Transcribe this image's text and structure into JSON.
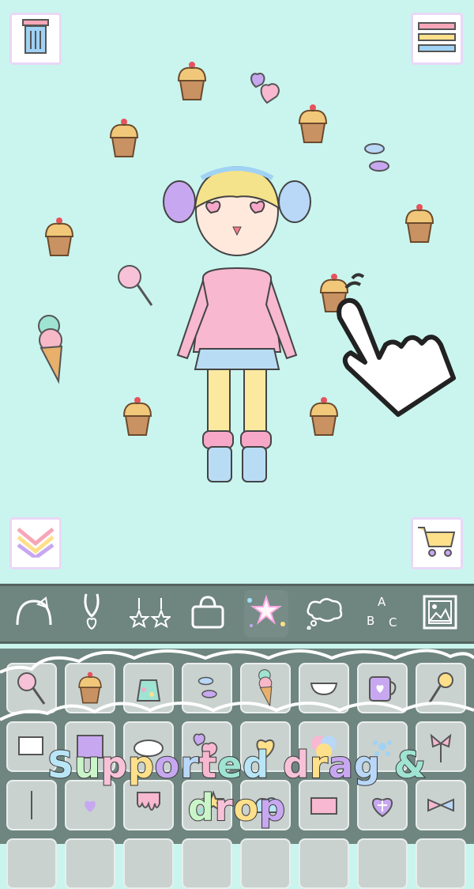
{
  "canvas": {
    "background": "#c9f5ee",
    "top_left_button": {
      "icon": "trash-icon"
    },
    "top_right_button": {
      "icon": "menu-icon"
    },
    "bottom_left_button": {
      "icon": "collapse-chevron-icon"
    },
    "bottom_right_button": {
      "icon": "shopping-cart-icon"
    }
  },
  "toolbar": {
    "tabs": [
      {
        "icon": "headband-icon"
      },
      {
        "icon": "necklace-icon"
      },
      {
        "icon": "star-earrings-icon"
      },
      {
        "icon": "handbag-icon"
      },
      {
        "icon": "sparkle-stars-icon",
        "selected": true
      },
      {
        "icon": "thought-cloud-icon"
      },
      {
        "icon": "abc-letters-icon",
        "text": "A B C"
      },
      {
        "icon": "picture-frame-icon"
      }
    ]
  },
  "banner": {
    "text": "Supported drag & drop"
  },
  "colors": {
    "mint": "#c9f5ee",
    "toolbar": "#6f8580",
    "cell": "#c9d2cf"
  }
}
